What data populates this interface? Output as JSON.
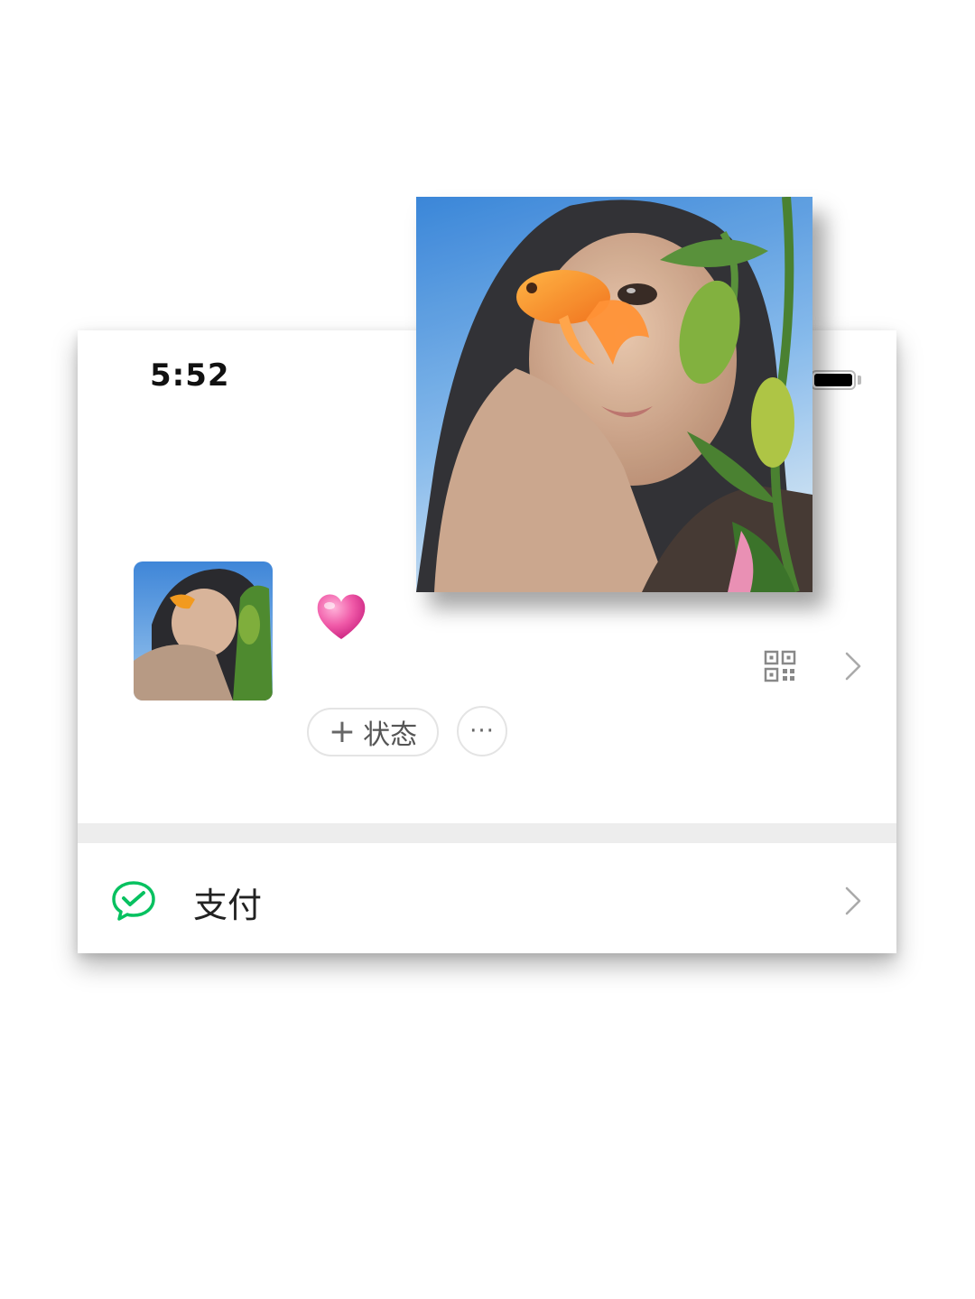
{
  "status_bar": {
    "time": "5:52"
  },
  "profile": {
    "emoji_icon": "pink-heart",
    "status_button_label": "状态",
    "more_button_label": "···"
  },
  "menu": {
    "pay_label": "支付"
  },
  "colors": {
    "pay_green": "#07C160",
    "divider_gray": "#EDEDED"
  }
}
